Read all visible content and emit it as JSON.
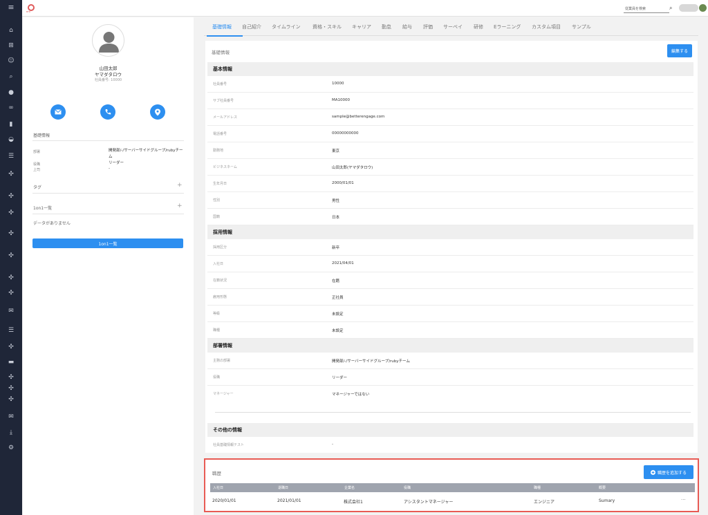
{
  "topbar": {
    "search_placeholder": "従業員を検索",
    "logo_sub": "BTR"
  },
  "profile": {
    "name": "山田太郎",
    "kana": "ヤマダタロウ",
    "employee_no": "社員番号: 10000"
  },
  "left": {
    "basic_info_label": "基礎情報",
    "fields": [
      {
        "key": "部署",
        "value": "開発部/-/サーバーサイドグループ/rubyチーム"
      },
      {
        "key": "役職",
        "value": "リーダー"
      },
      {
        "key": "上司",
        "value": "-"
      }
    ],
    "tag_label": "タグ",
    "oneonone_label": "1on1一覧",
    "no_data": "データがありません",
    "oneonone_button": "1on1一覧"
  },
  "tabs": [
    "基礎情報",
    "自己紹介",
    "タイムライン",
    "資格・スキル",
    "キャリア",
    "勤怠",
    "給与",
    "評価",
    "サーベイ",
    "研修",
    "Eラーニング",
    "カスタム項目",
    "サンプル"
  ],
  "card": {
    "title": "基礎情報",
    "edit_button": "編集する",
    "sections": [
      {
        "heading": "基本情報",
        "rows": [
          {
            "k": "社員番号",
            "v": "10000"
          },
          {
            "k": "サブ社員番号",
            "v": "MA10000"
          },
          {
            "k": "メールアドレス",
            "v": "sample@betterengage.com"
          },
          {
            "k": "電話番号",
            "v": "00000000000"
          },
          {
            "k": "勤務地",
            "v": "東京"
          },
          {
            "k": "ビジネスネーム",
            "v": "山田太郎(ヤマダタロウ)"
          },
          {
            "k": "生年月日",
            "v": "2000/01/01"
          },
          {
            "k": "性別",
            "v": "男性"
          },
          {
            "k": "国籍",
            "v": "日本"
          }
        ]
      },
      {
        "heading": "採用情報",
        "rows": [
          {
            "k": "採用区分",
            "v": "新卒"
          },
          {
            "k": "入社日",
            "v": "2021/04/01"
          },
          {
            "k": "在籍状況",
            "v": "在籍"
          },
          {
            "k": "雇用形態",
            "v": "正社員"
          },
          {
            "k": "等級",
            "v": "未設定"
          },
          {
            "k": "職種",
            "v": "未設定"
          }
        ]
      },
      {
        "heading": "部署情報",
        "rows": [
          {
            "k": "主務の部署",
            "v": "開発部/-/サーバーサイドグループ/rubyチーム"
          },
          {
            "k": "役職",
            "v": "リーダー"
          },
          {
            "k": "マネージャー",
            "v": "マネージャーではない"
          }
        ]
      },
      {
        "heading": "その他の情報",
        "rows": [
          {
            "k": "社員基礎情報テスト",
            "v": "-"
          }
        ]
      }
    ]
  },
  "history": {
    "title": "職歴",
    "add_button": "職歴を追加する",
    "columns": [
      "入社日",
      "退職日",
      "企業名",
      "役職",
      "職種",
      "概要"
    ],
    "row": [
      "2020/01/01",
      "2021/01/01",
      "株式会社1",
      "アシスタントマネージャー",
      "エンジニア",
      "Sumary"
    ]
  }
}
